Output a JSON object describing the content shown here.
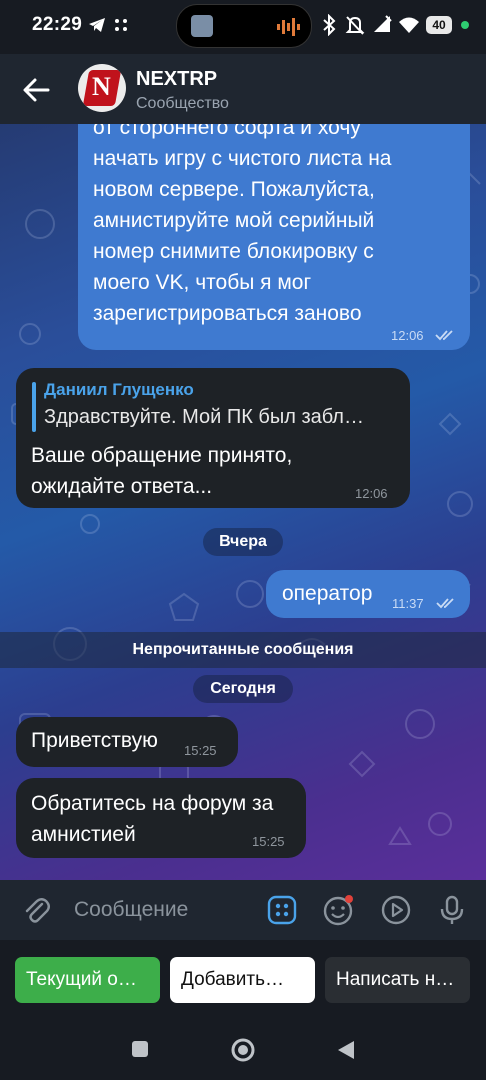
{
  "status_bar": {
    "time": "22:29",
    "battery": "40"
  },
  "header": {
    "title": "NEXTRP",
    "subtitle": "Сообщество",
    "avatar_letter": "N"
  },
  "messages": [
    {
      "id": "m1",
      "direction": "outgoing",
      "lines": [
        "от стороннего софта и хочу",
        "начать игру с чистого листа на",
        "новом сервере. Пожалуйста,",
        "амнистируйте мой серийный",
        "номер  снимите блокировку с",
        "моего VK, чтобы я мог",
        "зарегистрироваться заново"
      ],
      "time": "12:06"
    },
    {
      "id": "m2",
      "direction": "incoming",
      "reply_name": "Даниил Глущенко",
      "reply_text": "Здравствуйте. Мой ПК был забл…",
      "lines": [
        "Ваше обращение принято,",
        "ожидайте ответа..."
      ],
      "time": "12:06"
    },
    {
      "id": "m3",
      "direction": "outgoing",
      "lines": [
        "оператор"
      ],
      "time": "11:37"
    },
    {
      "id": "m4",
      "direction": "incoming",
      "lines": [
        "Приветствую"
      ],
      "time": "15:25"
    },
    {
      "id": "m5",
      "direction": "incoming",
      "lines": [
        "Обратитесь на форум за",
        "амнистией"
      ],
      "time": "15:25"
    }
  ],
  "separators": {
    "yesterday": "Вчера",
    "unread": "Непрочитанные сообщения",
    "today": "Сегодня"
  },
  "input": {
    "placeholder": "Сообщение"
  },
  "bot_buttons": [
    {
      "label": "Текущий о…",
      "color": "#3dae4a"
    },
    {
      "label": "Добавить…",
      "color": "#ffffff"
    },
    {
      "label": "Написать н…",
      "color": "#2a2e33"
    }
  ],
  "colors": {
    "outgoing_bubble": "#3f7ad0",
    "incoming_bubble": "#1e2226",
    "accent": "#4aa3ea"
  }
}
